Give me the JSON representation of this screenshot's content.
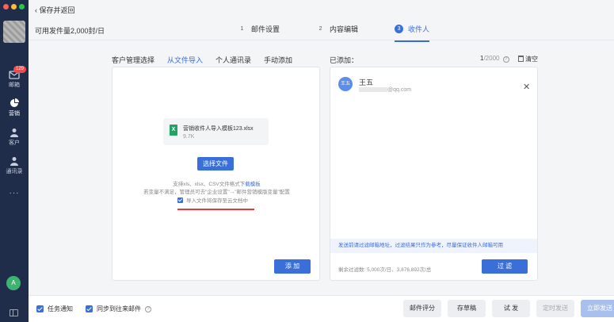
{
  "header": {
    "back_label": "保存并返回",
    "quota": "可用发件量2,000封/日",
    "steps": [
      {
        "num": "1",
        "label": "邮件设置"
      },
      {
        "num": "2",
        "label": "内容编辑"
      },
      {
        "num": "3",
        "label": "收件人"
      }
    ]
  },
  "sidebar": {
    "badge": "129",
    "items": [
      {
        "label": "邮箱"
      },
      {
        "label": "营销"
      },
      {
        "label": "客户"
      },
      {
        "label": "通讯录"
      }
    ],
    "more": "···",
    "user_initial": "A"
  },
  "tabs": [
    "客户管理选择",
    "从文件导入",
    "个人通讯录",
    "手动添加"
  ],
  "import": {
    "file_name": "营销收件人导入模板123.xlsx",
    "file_size": "9.7K",
    "file_icon": "X",
    "choose_button": "选择文件",
    "support_text": "支持xls、xlsx、CSV文件格式",
    "download_link": "下载模板",
    "vars_text": "若变量不满足，管理员可去\"企业设置\"→\"邮件营销模版变量\"配置",
    "save_text": "导入文件将保存至云文档中",
    "add_button": "添 加"
  },
  "recipients": {
    "label": "已添加：",
    "count": "1",
    "max": "/2000",
    "clear_label": "清空",
    "contact": {
      "avatar": "王五",
      "name": "王五",
      "email_suffix": "@qq.com"
    },
    "notice": "发送前请过滤邮箱地址，过滤结果只作为参考，尽量保证收件人邮箱可用",
    "remaining": "剩余过滤数: 5,000次/日、3,876,892次/总",
    "filter_button": "过 滤"
  },
  "footer": {
    "task_notify": "任务通知",
    "sync_label": "同步到往来邮件",
    "score": "邮件评分",
    "draft": "存草稿",
    "test": "试 发",
    "schedule": "定时发送",
    "send_now": "立即发送"
  },
  "colors": {
    "primary": "#3b6fd8",
    "sidebar": "#1f2d4a",
    "highlight_line": "#e23b3b"
  }
}
